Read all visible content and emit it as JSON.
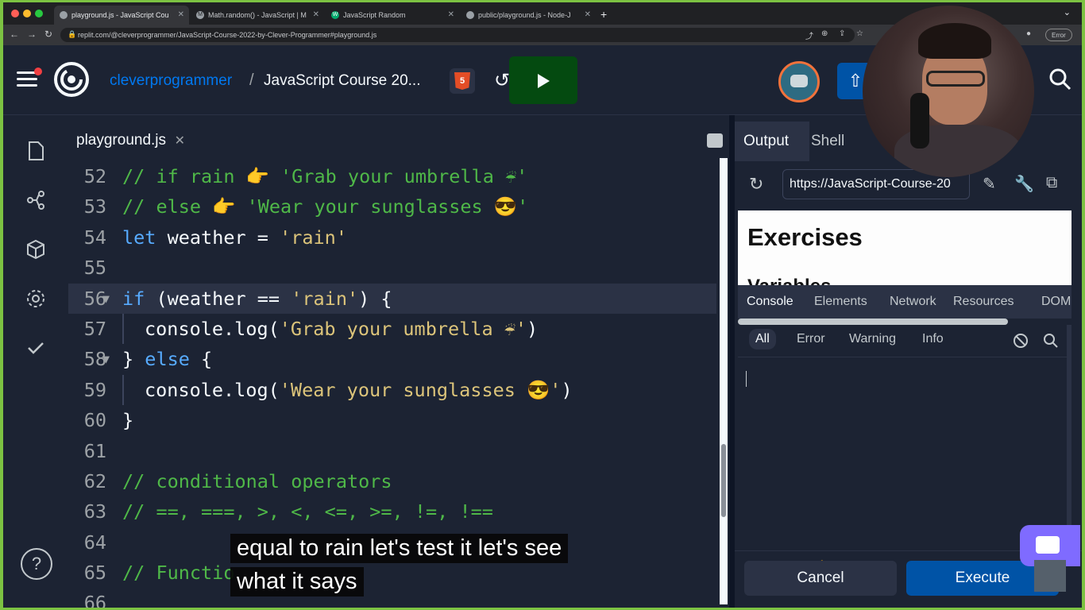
{
  "browser": {
    "tabs": [
      {
        "label": "playground.js - JavaScript Cou",
        "active": true
      },
      {
        "label": "Math.random() - JavaScript | M",
        "active": false
      },
      {
        "label": "JavaScript Random",
        "active": false
      },
      {
        "label": "public/playground.js - Node-J",
        "active": false
      }
    ],
    "url": "replit.com/@cleverprogrammer/JavaScript-Course-2022-by-Clever-Programmer#playground.js",
    "error_badge": "Error"
  },
  "header": {
    "owner": "cleverprogrammer",
    "separator": "/",
    "repl_name": "JavaScript Course 20...",
    "language_icon": "html5-icon",
    "lang_glyph": "5"
  },
  "editor": {
    "file_tab": "playground.js",
    "lines": [
      {
        "n": "52",
        "fold": false,
        "indent": 0,
        "active": false,
        "tokens": [
          {
            "t": "// if rain 👉 'Grab your umbrella ☔'",
            "c": "c"
          }
        ]
      },
      {
        "n": "53",
        "fold": false,
        "indent": 0,
        "active": false,
        "tokens": [
          {
            "t": "// else 👉 'Wear your sunglasses 😎'",
            "c": "c"
          }
        ]
      },
      {
        "n": "54",
        "fold": false,
        "indent": 0,
        "active": false,
        "tokens": [
          {
            "t": "let",
            "c": "k"
          },
          {
            "t": " weather = ",
            "c": ""
          },
          {
            "t": "'rain'",
            "c": "s"
          }
        ]
      },
      {
        "n": "55",
        "fold": false,
        "indent": 0,
        "active": false,
        "tokens": []
      },
      {
        "n": "56",
        "fold": true,
        "indent": 0,
        "active": true,
        "tokens": [
          {
            "t": "if",
            "c": "k"
          },
          {
            "t": " (weather == ",
            "c": ""
          },
          {
            "t": "'rain'",
            "c": "s"
          },
          {
            "t": ") {",
            "c": ""
          }
        ]
      },
      {
        "n": "57",
        "fold": false,
        "indent": 1,
        "active": false,
        "tokens": [
          {
            "t": "console.log(",
            "c": ""
          },
          {
            "t": "'Grab your umbrella ☔'",
            "c": "s"
          },
          {
            "t": ")",
            "c": ""
          }
        ]
      },
      {
        "n": "58",
        "fold": true,
        "indent": 0,
        "active": false,
        "tokens": [
          {
            "t": "} ",
            "c": ""
          },
          {
            "t": "else",
            "c": "k"
          },
          {
            "t": " {",
            "c": ""
          }
        ]
      },
      {
        "n": "59",
        "fold": false,
        "indent": 1,
        "active": false,
        "tokens": [
          {
            "t": "console.log(",
            "c": ""
          },
          {
            "t": "'Wear your sunglasses 😎'",
            "c": "s"
          },
          {
            "t": ")",
            "c": ""
          }
        ]
      },
      {
        "n": "60",
        "fold": false,
        "indent": 0,
        "active": false,
        "tokens": [
          {
            "t": "}",
            "c": ""
          }
        ]
      },
      {
        "n": "61",
        "fold": false,
        "indent": 0,
        "active": false,
        "tokens": []
      },
      {
        "n": "62",
        "fold": false,
        "indent": 0,
        "active": false,
        "tokens": [
          {
            "t": "// conditional operators",
            "c": "c"
          }
        ]
      },
      {
        "n": "63",
        "fold": false,
        "indent": 0,
        "active": false,
        "tokens": [
          {
            "t": "// ==, ===, >, <, <=, >=, !=, !==",
            "c": "c"
          }
        ]
      },
      {
        "n": "64",
        "fold": false,
        "indent": 0,
        "active": false,
        "tokens": []
      },
      {
        "n": "65",
        "fold": false,
        "indent": 0,
        "active": false,
        "tokens": [
          {
            "t": "// Functio",
            "c": "c"
          }
        ]
      },
      {
        "n": "66",
        "fold": false,
        "indent": 0,
        "active": false,
        "tokens": []
      }
    ]
  },
  "subtitles": {
    "line1": "equal to rain let's test it let's see",
    "line2": "what it says"
  },
  "output": {
    "tabs": [
      "Output",
      "Shell"
    ],
    "url": "https://JavaScript-Course-20",
    "page_title": "Exercises",
    "page_subtitle": "Variables",
    "devtools_tabs": [
      "Console",
      "Elements",
      "Network",
      "Resources",
      "DOM"
    ],
    "filters": [
      "All",
      "Error",
      "Warning",
      "Info"
    ],
    "cancel_label": "Cancel",
    "execute_label": "Execute"
  },
  "colors": {
    "bg": "#0e1525",
    "panel": "#1c2333",
    "comment": "#4fb848",
    "keyword": "#57abff",
    "string": "#dcc47a",
    "execute": "#0053a6",
    "run": "#044a10",
    "frame": "#7cc242"
  }
}
